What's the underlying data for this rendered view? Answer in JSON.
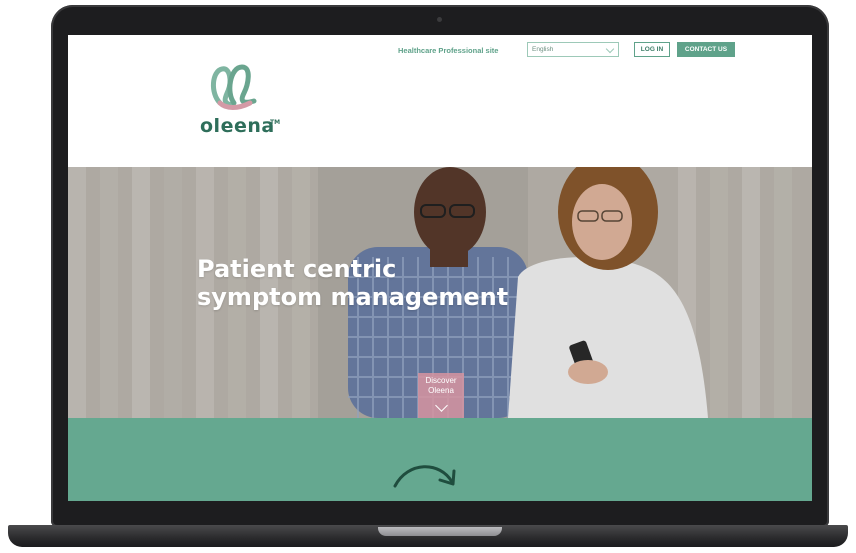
{
  "header": {
    "hcp_link": "Healthcare Professional site",
    "language_value": "English",
    "login_label": "LOG IN",
    "contact_label": "CONTACT US"
  },
  "brand": {
    "name": "oleena",
    "tm": "TM"
  },
  "hero": {
    "title_line1": "Patient centric",
    "title_line2": "symptom management",
    "discover_line1": "Discover",
    "discover_line2": "Oleena"
  },
  "colors": {
    "accent_green": "#5fa28a",
    "band_green": "#65a890",
    "logo_dark": "#2e6e5a",
    "discover_pink": "#d694a0"
  },
  "icons": {
    "logo": "oleena-loop-logo",
    "discover_arrow": "chevron-down-icon",
    "band_arrow": "curved-arrow-icon",
    "select_caret": "chevron-down-icon"
  }
}
